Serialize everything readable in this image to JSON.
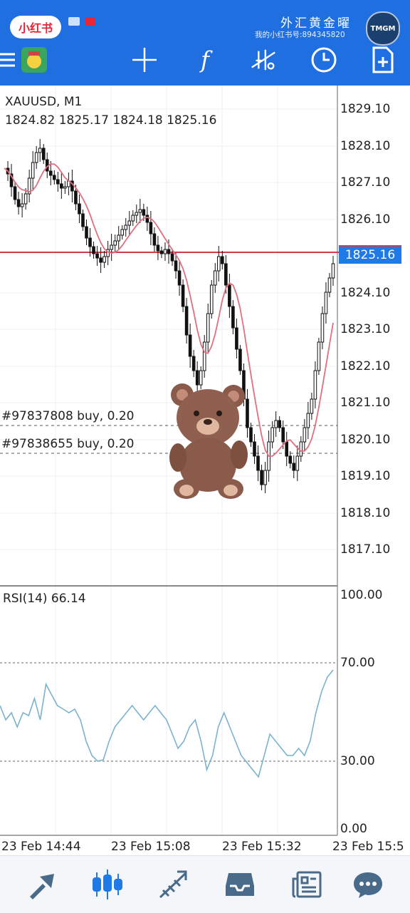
{
  "status_bar": {
    "app_badge": "小红书",
    "watermark_title": "外汇黄金曜",
    "watermark_subtitle": "我的小红书号:894345820",
    "watermark_logo": "TMGM"
  },
  "toolbar": {
    "icons": [
      "menu-icon",
      "account-icon",
      "crosshair-icon",
      "indicators-icon",
      "objects-icon",
      "timeframe-clock-icon",
      "new-order-icon"
    ],
    "accent": "#1f6fe0"
  },
  "chart": {
    "symbol": "XAUUSD, M1",
    "ohlc": "1824.82 1825.17 1824.18 1825.16",
    "current_price": "1825.16",
    "price_ticks": [
      "1829.10",
      "1828.10",
      "1827.10",
      "1826.10",
      "1825.16",
      "1824.10",
      "1823.10",
      "1822.10",
      "1821.10",
      "1820.10",
      "1819.10",
      "1818.10",
      "1817.10"
    ],
    "orders": [
      "#97837808 buy, 0.20",
      "#97838655 buy, 0.20"
    ],
    "time_ticks": [
      "23 Feb 14:44",
      "23 Feb 15:08",
      "23 Feb 15:32",
      "23 Feb 15:5"
    ],
    "bid_line_color": "#d33a4a",
    "ma_color": "#e07080"
  },
  "rsi": {
    "label": "RSI(14) 66.14",
    "ticks": [
      "100.00",
      "70.00",
      "30.00",
      "0.00"
    ],
    "line_color": "#7ab3cc"
  },
  "bottom_nav": {
    "items": [
      "quotes-icon",
      "chart-icon",
      "trade-icon",
      "history-icon",
      "news-icon",
      "chat-icon"
    ],
    "active": "chart-icon"
  }
}
